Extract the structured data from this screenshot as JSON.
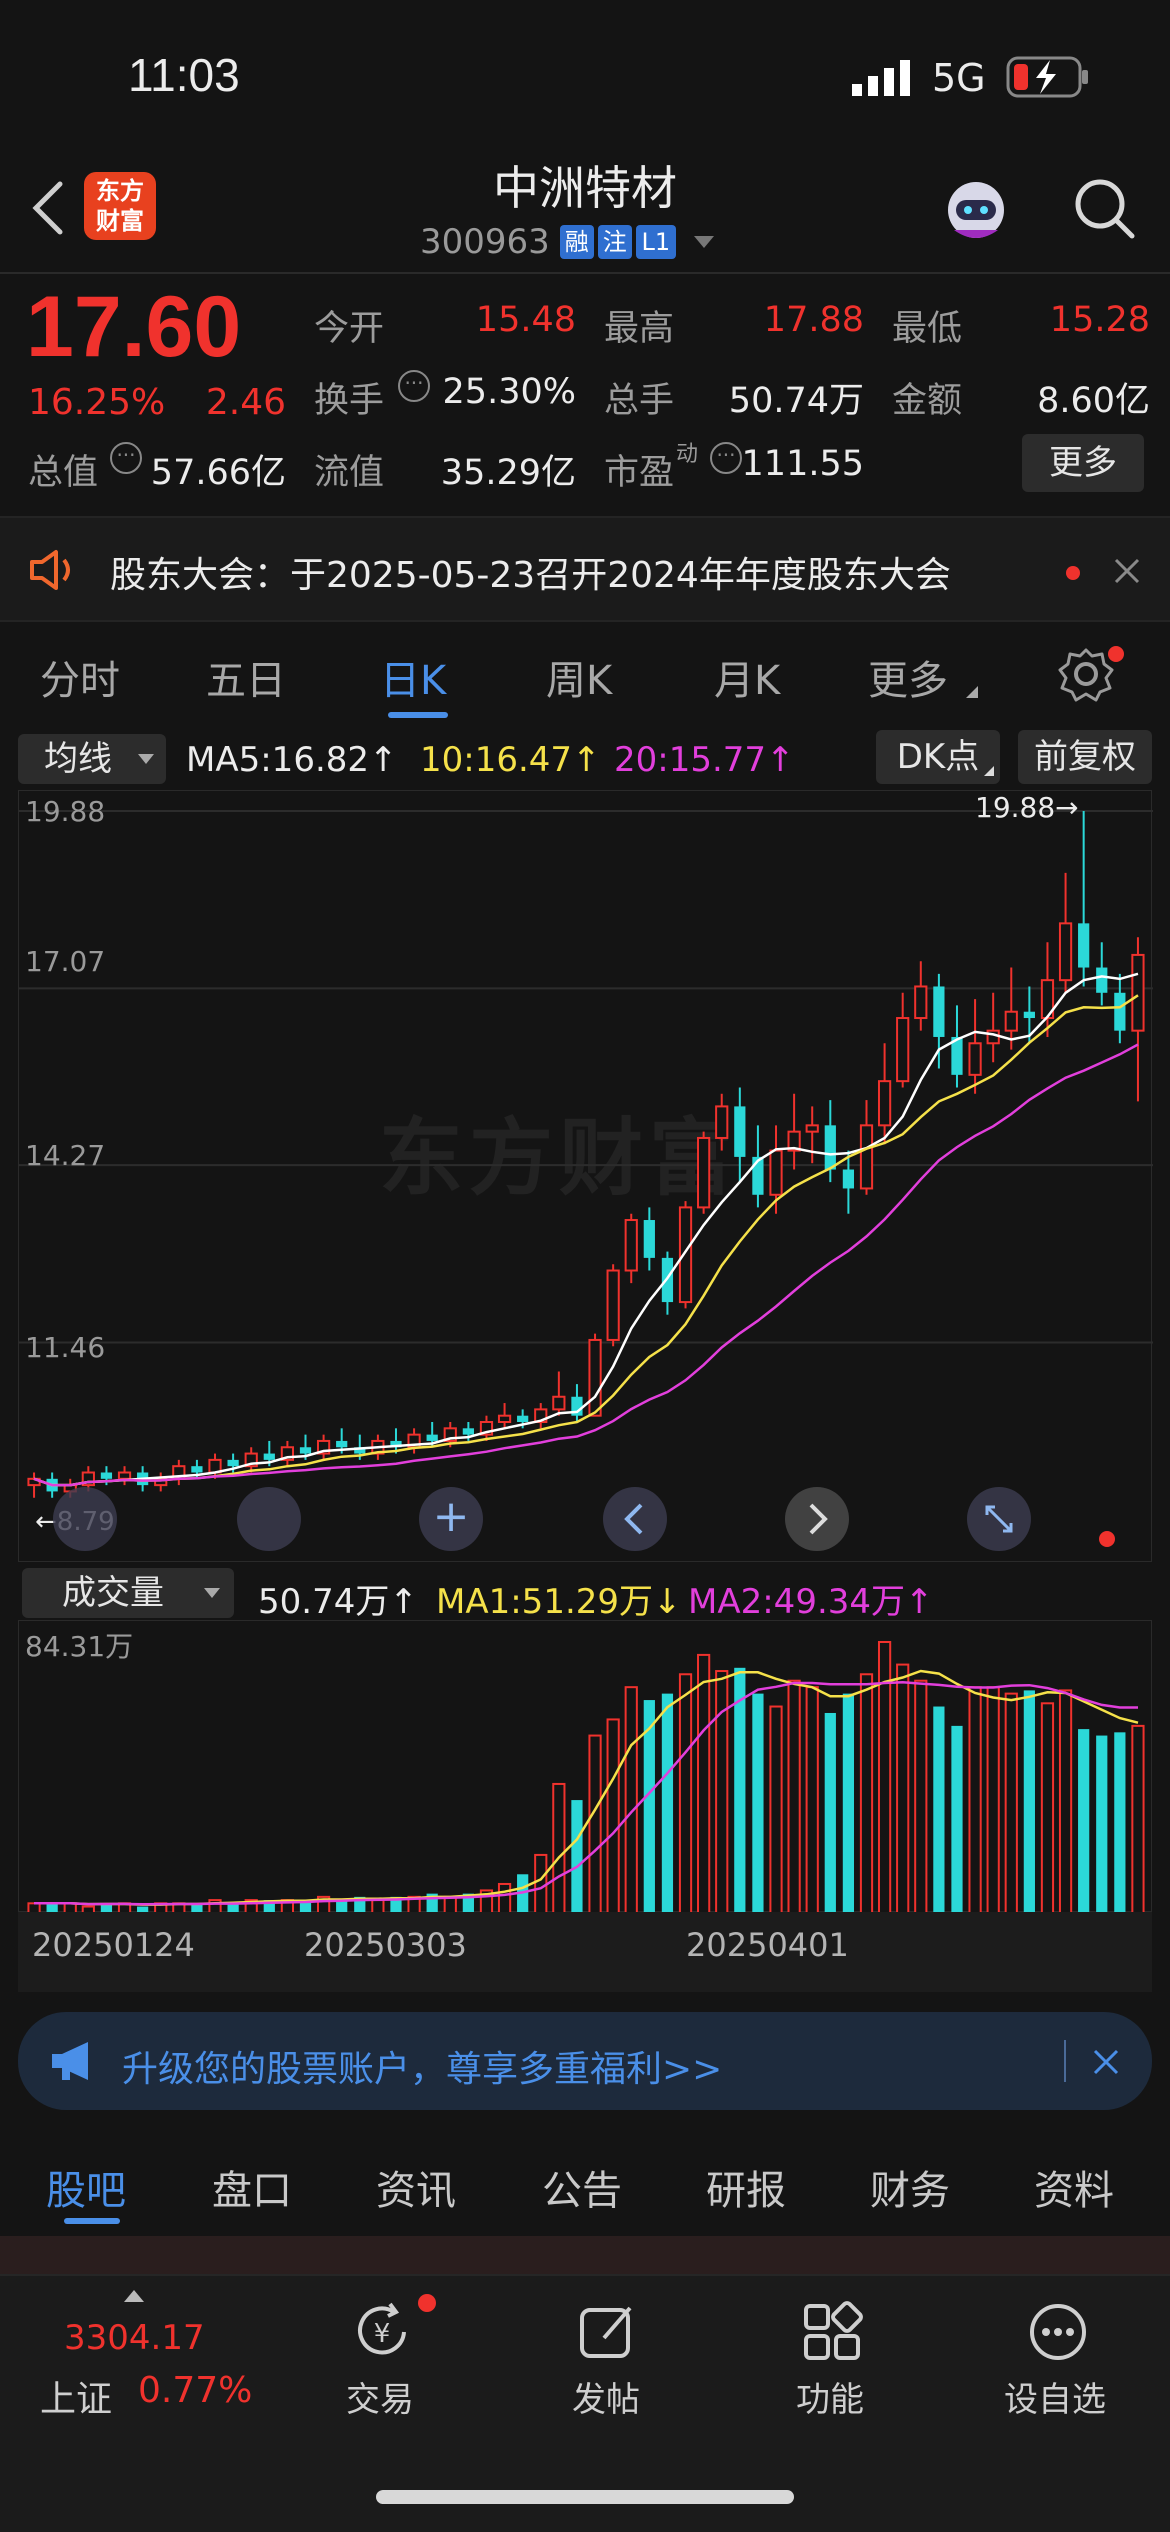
{
  "status_bar": {
    "time": "11:03",
    "network": "5G"
  },
  "header": {
    "logo_text": "东方\n财富",
    "stock_name": "中洲特材",
    "stock_code": "300963",
    "badges": [
      "融",
      "注",
      "L1"
    ]
  },
  "quote": {
    "price": "17.60",
    "change_pct": "16.25%",
    "change": "2.46",
    "open_label": "今开",
    "open": "15.48",
    "high_label": "最高",
    "high": "17.88",
    "low_label": "最低",
    "low": "15.28",
    "turnover_label": "换手",
    "turnover": "25.30%",
    "volume_label": "总手",
    "volume": "50.74万",
    "amount_label": "金额",
    "amount": "8.60亿",
    "mktcap_label": "总值",
    "mktcap": "57.66亿",
    "float_label": "流值",
    "float": "35.29亿",
    "pe_label": "市盈",
    "pe_sup": "动",
    "pe": "111.55",
    "more": "更多"
  },
  "notice": {
    "text": "股东大会：于2025-05-23召开2024年年度股东大会"
  },
  "chart_tabs": [
    "分时",
    "五日",
    "日K",
    "周K",
    "月K",
    "更多"
  ],
  "active_tab": "日K",
  "ma_bar": {
    "selector": "均线",
    "ma5": "MA5:16.82",
    "ma10": "10:16.47",
    "ma20": "20:15.77",
    "dk": "DK点",
    "adj": "前复权"
  },
  "price_axis": [
    "19.88",
    "17.07",
    "14.27",
    "11.46"
  ],
  "max_marker": "19.88→",
  "min_marker": "←8.79",
  "watermark": "东方财富",
  "vol_bar": {
    "selector": "成交量",
    "vol": "50.74万",
    "ma1": "MA1:51.29万",
    "ma2": "MA2:49.34万"
  },
  "vol_axis": "84.31万",
  "dates": [
    "20250124",
    "20250303",
    "20250401"
  ],
  "promo": {
    "text": "升级您的股票账户，尊享多重福利>>"
  },
  "bottom_tabs": [
    "股吧",
    "盘口",
    "资讯",
    "公告",
    "研报",
    "财务",
    "资料"
  ],
  "footer": {
    "index_value": "3304.17",
    "index_name": "上证",
    "index_pct": "0.77%",
    "nav": [
      "交易",
      "发帖",
      "功能",
      "设自选"
    ]
  },
  "colors": {
    "up": "#f0322d",
    "down": "#2bd8d8",
    "ma5": "#ffffff",
    "ma10": "#f5e14a",
    "ma20": "#e23fdc",
    "accent": "#4a8fe8"
  },
  "chart_data": {
    "type": "candlestick",
    "xlabels": [
      "20250124",
      "20250303",
      "20250401"
    ],
    "ylim": [
      8.79,
      19.88
    ],
    "candles": [
      [
        9.2,
        9.3,
        9.0,
        9.4
      ],
      [
        9.3,
        9.1,
        9.0,
        9.4
      ],
      [
        9.1,
        9.2,
        9.0,
        9.3
      ],
      [
        9.2,
        9.4,
        9.1,
        9.5
      ],
      [
        9.4,
        9.3,
        9.2,
        9.5
      ],
      [
        9.3,
        9.4,
        9.2,
        9.5
      ],
      [
        9.4,
        9.2,
        9.1,
        9.5
      ],
      [
        9.2,
        9.3,
        9.1,
        9.4
      ],
      [
        9.3,
        9.5,
        9.2,
        9.6
      ],
      [
        9.5,
        9.4,
        9.3,
        9.6
      ],
      [
        9.4,
        9.6,
        9.3,
        9.7
      ],
      [
        9.6,
        9.5,
        9.4,
        9.7
      ],
      [
        9.5,
        9.7,
        9.4,
        9.8
      ],
      [
        9.7,
        9.6,
        9.5,
        9.9
      ],
      [
        9.6,
        9.8,
        9.5,
        9.9
      ],
      [
        9.8,
        9.7,
        9.6,
        10.0
      ],
      [
        9.7,
        9.9,
        9.6,
        10.0
      ],
      [
        9.9,
        9.8,
        9.7,
        10.1
      ],
      [
        9.8,
        9.7,
        9.6,
        10.0
      ],
      [
        9.7,
        9.9,
        9.6,
        10.0
      ],
      [
        9.9,
        9.8,
        9.7,
        10.1
      ],
      [
        9.8,
        10.0,
        9.7,
        10.1
      ],
      [
        10.0,
        9.9,
        9.8,
        10.2
      ],
      [
        9.9,
        10.1,
        9.8,
        10.2
      ],
      [
        10.1,
        10.0,
        9.9,
        10.2
      ],
      [
        10.0,
        10.2,
        9.9,
        10.3
      ],
      [
        10.2,
        10.3,
        10.1,
        10.5
      ],
      [
        10.3,
        10.2,
        10.1,
        10.4
      ],
      [
        10.2,
        10.4,
        10.1,
        10.5
      ],
      [
        10.4,
        10.6,
        10.3,
        11.0
      ],
      [
        10.6,
        10.3,
        10.2,
        10.8
      ],
      [
        10.3,
        11.5,
        10.3,
        11.6
      ],
      [
        11.5,
        12.6,
        11.4,
        12.7
      ],
      [
        12.6,
        13.4,
        12.4,
        13.5
      ],
      [
        13.4,
        12.8,
        12.6,
        13.6
      ],
      [
        12.8,
        12.1,
        11.9,
        12.9
      ],
      [
        12.1,
        13.6,
        12.0,
        13.7
      ],
      [
        13.6,
        14.7,
        13.5,
        14.8
      ],
      [
        14.7,
        15.2,
        14.5,
        15.4
      ],
      [
        15.2,
        14.4,
        14.0,
        15.5
      ],
      [
        14.4,
        13.8,
        13.6,
        14.9
      ],
      [
        13.8,
        14.5,
        13.5,
        14.9
      ],
      [
        14.5,
        14.8,
        14.2,
        15.4
      ],
      [
        14.8,
        14.9,
        14.3,
        15.2
      ],
      [
        14.9,
        14.2,
        14.0,
        15.3
      ],
      [
        14.2,
        13.9,
        13.5,
        14.5
      ],
      [
        13.9,
        14.9,
        13.8,
        15.3
      ],
      [
        14.9,
        15.6,
        14.6,
        16.2
      ],
      [
        15.6,
        16.6,
        15.5,
        17.0
      ],
      [
        16.6,
        17.1,
        16.4,
        17.5
      ],
      [
        17.1,
        16.3,
        15.8,
        17.3
      ],
      [
        16.3,
        15.7,
        15.5,
        16.8
      ],
      [
        15.7,
        16.2,
        15.4,
        16.9
      ],
      [
        16.2,
        16.4,
        15.9,
        17.0
      ],
      [
        16.4,
        16.7,
        16.1,
        17.4
      ],
      [
        16.7,
        16.6,
        16.2,
        17.1
      ],
      [
        16.6,
        17.2,
        16.3,
        17.8
      ],
      [
        17.2,
        18.1,
        17.0,
        18.9
      ],
      [
        18.1,
        17.4,
        17.1,
        19.88
      ],
      [
        17.4,
        17.0,
        16.8,
        17.8
      ],
      [
        17.0,
        16.4,
        16.2,
        17.3
      ],
      [
        16.4,
        17.6,
        15.28,
        17.88
      ]
    ],
    "volumes": [
      3,
      3,
      3,
      2,
      3,
      3,
      2,
      3,
      3,
      3,
      4,
      3,
      4,
      4,
      4,
      4,
      5,
      4,
      5,
      4,
      5,
      5,
      6,
      5,
      6,
      7,
      9,
      12,
      18,
      40,
      35,
      55,
      60,
      70,
      66,
      68,
      74,
      80,
      75,
      76,
      68,
      64,
      72,
      70,
      62,
      68,
      74,
      84,
      77,
      72,
      64,
      58,
      70,
      70,
      68,
      69,
      65,
      69,
      57,
      55,
      56,
      58
    ]
  }
}
